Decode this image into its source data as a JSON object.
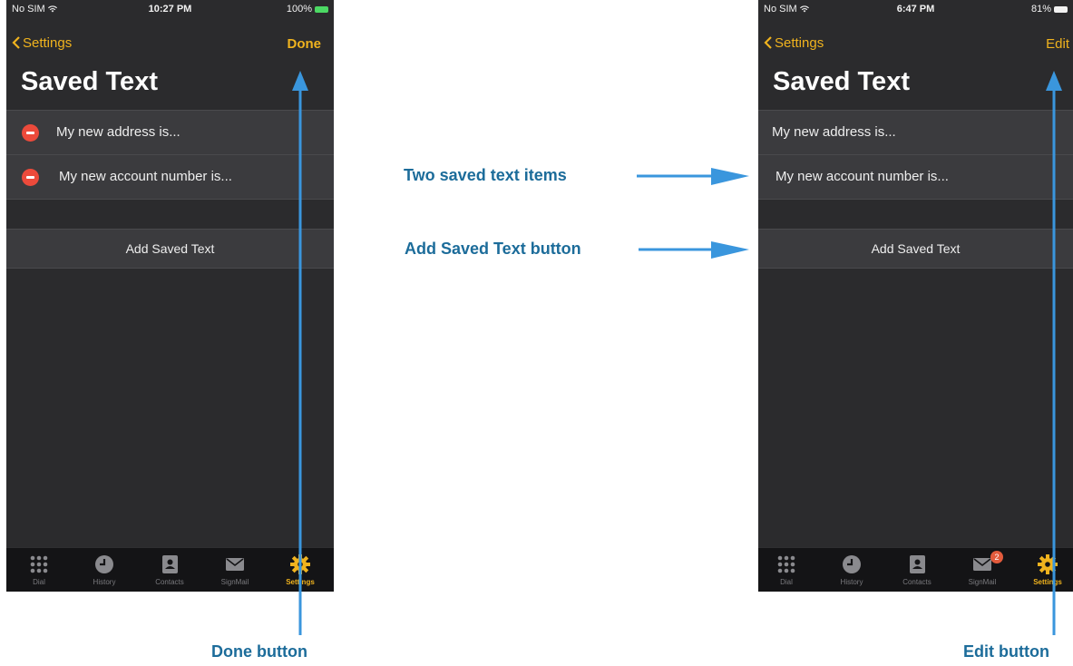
{
  "left_screen": {
    "status": {
      "carrier": "No SIM",
      "time": "10:27 PM",
      "battery": "100%"
    },
    "nav": {
      "back_label": "Settings",
      "right_label": "Done"
    },
    "title": "Saved Text",
    "items": [
      {
        "label": "My new address is..."
      },
      {
        "label": "My new account number is..."
      }
    ],
    "add_label": "Add Saved Text",
    "tabs": [
      {
        "label": "Dial",
        "icon": "keypad-icon"
      },
      {
        "label": "History",
        "icon": "clock-icon"
      },
      {
        "label": "Contacts",
        "icon": "contacts-book-icon"
      },
      {
        "label": "SignMail",
        "icon": "envelope-icon"
      },
      {
        "label": "Settings",
        "icon": "gear-icon"
      }
    ]
  },
  "right_screen": {
    "status": {
      "carrier": "No SIM",
      "time": "6:47 PM",
      "battery": "81%"
    },
    "nav": {
      "back_label": "Settings",
      "right_label": "Edit"
    },
    "title": "Saved Text",
    "items": [
      {
        "label": "My new address is..."
      },
      {
        "label": "My new account number is..."
      }
    ],
    "add_label": "Add Saved Text",
    "signmail_badge": "2",
    "tabs": [
      {
        "label": "Dial",
        "icon": "keypad-icon"
      },
      {
        "label": "History",
        "icon": "clock-icon"
      },
      {
        "label": "Contacts",
        "icon": "contacts-book-icon"
      },
      {
        "label": "SignMail",
        "icon": "envelope-icon"
      },
      {
        "label": "Settings",
        "icon": "gear-icon"
      }
    ]
  },
  "callouts": {
    "items": "Two saved text items",
    "add": "Add Saved Text button",
    "done": "Done button",
    "edit": "Edit button"
  },
  "colors": {
    "accent": "#f0b31e",
    "delete": "#ec4a3b",
    "callout": "#1c6c9a",
    "arrow": "#3a96dd",
    "background": "#2b2b2d"
  }
}
